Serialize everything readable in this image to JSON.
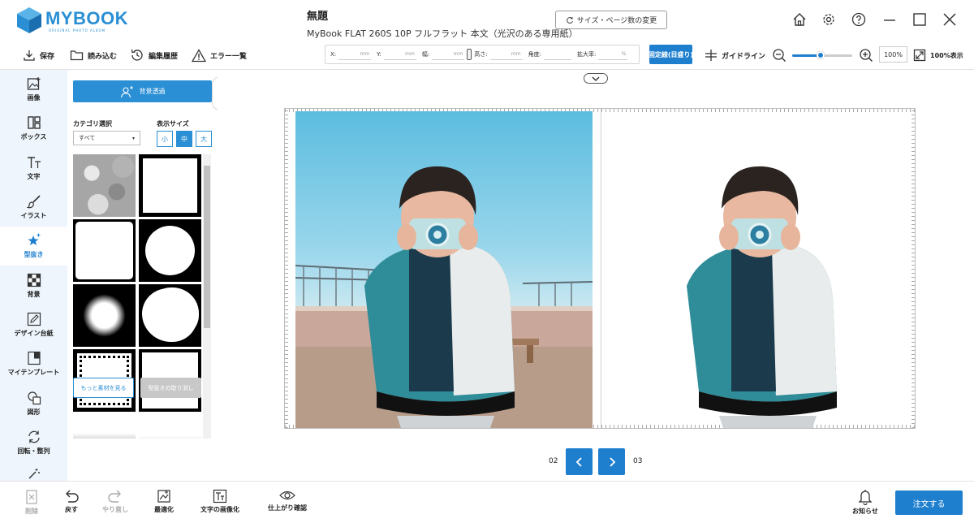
{
  "app": {
    "logo_text": "MYBOOK",
    "logo_sub": "ORIGINAL PHOTO ALBUM",
    "title": "無題",
    "subtitle": "MyBook FLAT 260S 10P フルフラット 本文（光沢のある専用紙）",
    "size_change_label": "サイズ・ページ数の変更"
  },
  "toolbar": {
    "save": "保存",
    "load": "読み込む",
    "history": "編集履歴",
    "errors": "エラー一覧",
    "x_label": "X:",
    "y_label": "Y:",
    "width_label": "幅:",
    "height_label": "高さ:",
    "angle_label": "角度:",
    "scale_label": "拡大率:",
    "unit_mm": "mm",
    "unit_pct": "%",
    "fixed_label": "固定線(目盛り)",
    "guideline": "ガイドライン",
    "zoom_value": "100%",
    "zoom_level": 0.47,
    "fit_100": "100%表示"
  },
  "sidebar": {
    "items": [
      {
        "label": "画像",
        "icon": "image-add-icon"
      },
      {
        "label": "ボックス",
        "icon": "box-icon"
      },
      {
        "label": "文字",
        "icon": "text-icon"
      },
      {
        "label": "イラスト",
        "icon": "brush-icon"
      },
      {
        "label": "型抜き",
        "icon": "star-cutout-icon"
      },
      {
        "label": "背景",
        "icon": "checker-icon"
      },
      {
        "label": "デザイン台紙",
        "icon": "pen-frame-icon"
      },
      {
        "label": "マイテンプレート",
        "icon": "template-icon"
      },
      {
        "label": "図形",
        "icon": "shape-icon"
      },
      {
        "label": "回転・整列",
        "icon": "rotate-icon"
      }
    ],
    "active_index": 4
  },
  "panel": {
    "bg_transparent": "背景透過",
    "category_label": "カテゴリ選択",
    "category_value": "すべて",
    "display_size_label": "表示サイズ",
    "sizes": [
      "小",
      "中",
      "大"
    ],
    "size_selected": 1,
    "more_materials": "もっと素材を見る",
    "cancel_cutout": "型抜きの取り消し"
  },
  "pager": {
    "left_page": "02",
    "right_page": "03"
  },
  "bottom": {
    "delete": "削除",
    "undo": "戻す",
    "redo": "やり直し",
    "optimize": "最適化",
    "text_to_image": "文字の画像化",
    "preview": "仕上がり確認",
    "notifications": "お知らせ",
    "order": "注文する"
  },
  "colors": {
    "accent": "#1e7fcf",
    "sidebar_bg": "#eef5fc"
  }
}
